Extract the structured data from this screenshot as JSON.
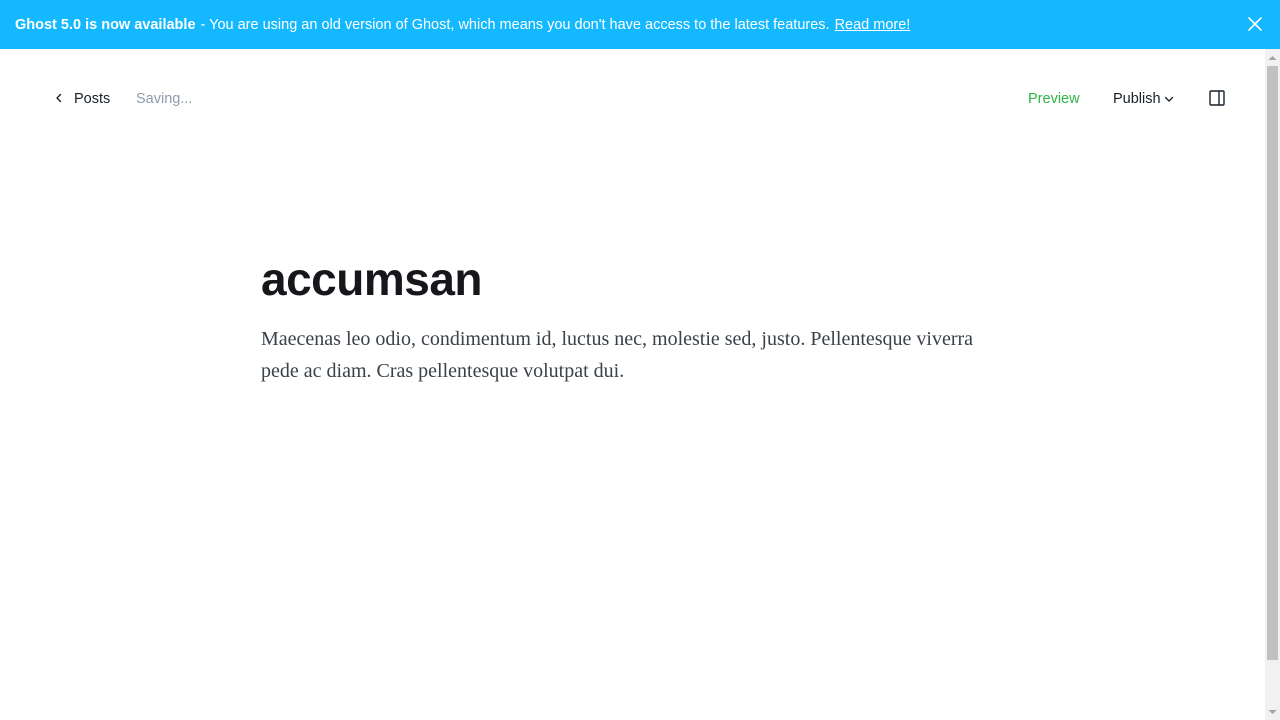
{
  "banner": {
    "title": "Ghost 5.0 is now available",
    "message": "- You are using an old version of Ghost, which means you don't have access to the latest features.",
    "link_label": "Read more!"
  },
  "header": {
    "back_label": "Posts",
    "status_text": "Saving...",
    "preview_label": "Preview",
    "publish_label": "Publish"
  },
  "post": {
    "title": "accumsan",
    "body": "Maecenas leo odio, condimentum id, luctus nec, molestie sed, justo. Pellentesque viverra pede ac diam. Cras pellentesque volutpat dui."
  },
  "colors": {
    "banner_bg": "#14b8ff",
    "preview_green": "#2fb346",
    "text_dark": "#15212a",
    "muted": "#8e9cac"
  },
  "icons": [
    "close-icon",
    "chevron-left-icon",
    "chevron-down-icon",
    "sidebar-toggle-icon"
  ]
}
